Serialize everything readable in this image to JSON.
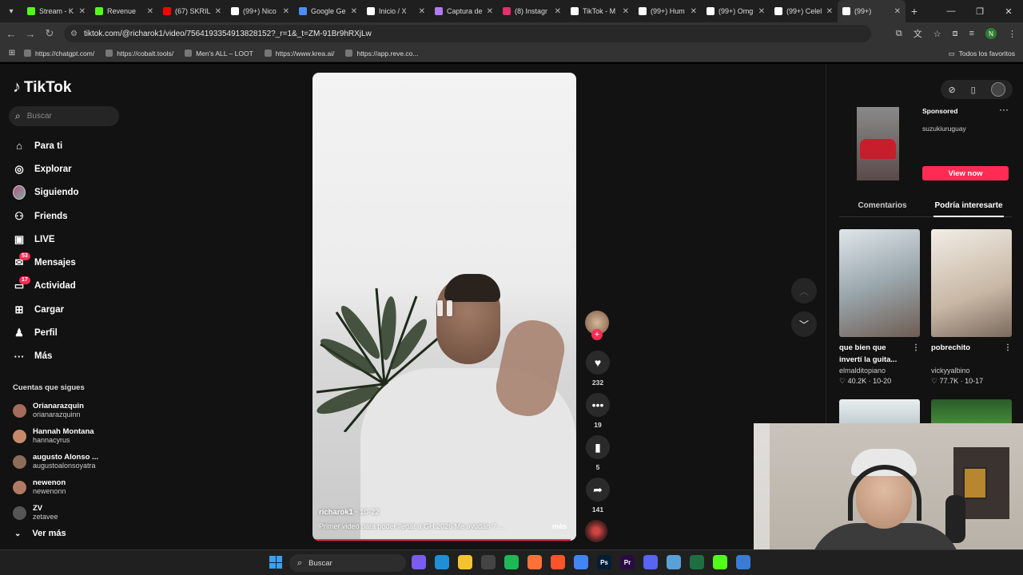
{
  "browser": {
    "tabs": [
      {
        "label": "Stream - K",
        "color": "#53fc18"
      },
      {
        "label": "Revenue",
        "color": "#53fc18"
      },
      {
        "label": "(67) SKRIL",
        "color": "#ff0000"
      },
      {
        "label": "(99+) Nico",
        "color": "#ffffff"
      },
      {
        "label": "Google Ge",
        "color": "#4f8df7"
      },
      {
        "label": "Inicio / X",
        "color": "#ffffff"
      },
      {
        "label": "Captura de",
        "color": "#b07cf0"
      },
      {
        "label": "(8) Instagr",
        "color": "#e1306c"
      },
      {
        "label": "TikTok - M",
        "color": "#ffffff"
      },
      {
        "label": "(99+) Hum",
        "color": "#ffffff"
      },
      {
        "label": "(99+) Omg",
        "color": "#ffffff"
      },
      {
        "label": "(99+) Celel",
        "color": "#ffffff"
      },
      {
        "label": "(99+)",
        "color": "#ffffff",
        "active": true
      }
    ],
    "url": "tiktok.com/@richarok1/video/7564193354913828152?_r=1&_t=ZM-91Br9hRXjLw",
    "profile_initial": "N",
    "bookmarks": [
      "https://chatgpt.com/",
      "https://cobalt.tools/",
      "Men's ALL – LOOT",
      "https://www.krea.ai/",
      "https://app.reve.co..."
    ],
    "all_bookmarks": "Todos los favoritos"
  },
  "tiktok": {
    "logo": "TikTok",
    "search_placeholder": "Buscar",
    "nav": [
      {
        "label": "Para ti",
        "icon": "home-icon"
      },
      {
        "label": "Explorar",
        "icon": "compass-icon"
      },
      {
        "label": "Siguiendo",
        "icon": "avatar-icon"
      },
      {
        "label": "Friends",
        "icon": "friends-icon"
      },
      {
        "label": "LIVE",
        "icon": "live-icon"
      },
      {
        "label": "Mensajes",
        "icon": "messages-icon",
        "badge": "53"
      },
      {
        "label": "Actividad",
        "icon": "activity-icon",
        "badge": "17"
      },
      {
        "label": "Cargar",
        "icon": "upload-icon"
      },
      {
        "label": "Perfil",
        "icon": "profile-icon"
      },
      {
        "label": "Más",
        "icon": "more-icon"
      }
    ],
    "following_title": "Cuentas que sigues",
    "following": [
      {
        "name": "Orianarazquin",
        "user": "orianarazquinn",
        "color": "#a46c5a"
      },
      {
        "name": "Hannah Montana",
        "user": "hannacyrus",
        "color": "#c68a6a"
      },
      {
        "name": "augusto Alonso ...",
        "user": "augustoalonsoyatra",
        "color": "#8b6d5a"
      },
      {
        "name": "newenon",
        "user": "newenonn",
        "color": "#b07a64"
      },
      {
        "name": "ZV",
        "user": "zetavee",
        "color": "#555555"
      }
    ],
    "ver_mas": "Ver más"
  },
  "video": {
    "author": "richarok1",
    "date": "10-22",
    "description": "Primer video para poder llegar a GH 2026 Me ayudan ? ...",
    "more": "más",
    "progress": 0.98,
    "likes": "232",
    "comments": "19",
    "saves": "5",
    "shares": "141"
  },
  "right_panel": {
    "ad_sponsored": "Sponsored",
    "ad_brand": "suzukiuruguay",
    "ad_button": "View now",
    "tabs": [
      "Comentarios",
      "Podría interesarte"
    ],
    "suggestions": [
      {
        "title": "que bien que invertí la guita...",
        "user": "elmalditopiano",
        "likes": "40.2K",
        "date": "10-20"
      },
      {
        "title": "pobrechito",
        "user": "vickyyalbino",
        "likes": "77.7K",
        "date": "10-17"
      }
    ]
  },
  "taskbar": {
    "search_placeholder": "Buscar",
    "apps": [
      {
        "name": "copilot-icon",
        "label": "",
        "color": "#7a5cf0"
      },
      {
        "name": "edge-icon",
        "label": "",
        "color": "#1f8fd6"
      },
      {
        "name": "file-explorer-icon",
        "label": "",
        "color": "#f4c430"
      },
      {
        "name": "obs-icon",
        "label": "",
        "color": "#444444"
      },
      {
        "name": "spotify-icon",
        "label": "",
        "color": "#1db954"
      },
      {
        "name": "firefox-icon",
        "label": "",
        "color": "#ff7139"
      },
      {
        "name": "brave-icon",
        "label": "",
        "color": "#fb542b"
      },
      {
        "name": "chrome-icon",
        "label": "",
        "color": "#4285f4"
      },
      {
        "name": "photoshop-icon",
        "label": "Ps",
        "color": "#001e36"
      },
      {
        "name": "premiere-icon",
        "label": "Pr",
        "color": "#2a0a44"
      },
      {
        "name": "discord-icon",
        "label": "",
        "color": "#5865f2"
      },
      {
        "name": "notepad-icon",
        "label": "",
        "color": "#5aa0d8"
      },
      {
        "name": "excel-icon",
        "label": "",
        "color": "#1d6f42"
      },
      {
        "name": "kick-icon",
        "label": "",
        "color": "#53fc18"
      },
      {
        "name": "paint-icon",
        "label": "",
        "color": "#3a7bd5"
      }
    ]
  }
}
